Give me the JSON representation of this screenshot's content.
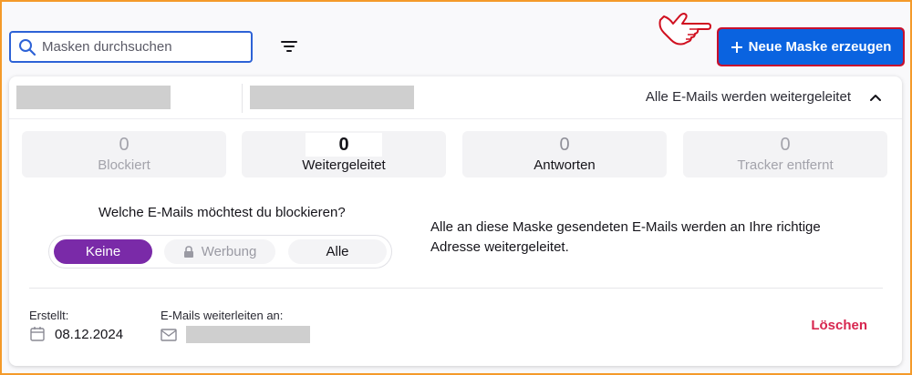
{
  "search": {
    "placeholder": "Masken durchsuchen"
  },
  "toolbar": {
    "new_mask_label": "Neue Maske erzeugen"
  },
  "mask": {
    "status_text": "Alle E-Mails werden weitergeleitet",
    "stats": [
      {
        "value": "0",
        "label": "Blockiert"
      },
      {
        "value": "0",
        "label": "Weitergeleitet"
      },
      {
        "value": "0",
        "label": "Antworten"
      },
      {
        "value": "0",
        "label": "Tracker entfernt"
      }
    ],
    "block_question": "Welche E-Mails möchtest du blockieren?",
    "block_options": [
      "Keine",
      "Werbung",
      "Alle"
    ],
    "selected_option": "Keine",
    "description": "Alle an diese Maske gesendeten E-Mails werden an Ihre richtige Adresse weitergeleitet.",
    "created_label": "Erstellt:",
    "created_date": "08.12.2024",
    "forward_label": "E-Mails weiterleiten an:",
    "delete_label": "Löschen"
  },
  "colors": {
    "primary_button": "#0a63e0",
    "highlight_border": "#c8102e",
    "selected_option": "#7a2aa8",
    "delete": "#d7264f",
    "frame": "#f49a2a"
  },
  "icons": [
    "search-icon",
    "filter-icon",
    "pointing-hand-icon",
    "plus-icon",
    "chevron-up-icon",
    "lock-icon",
    "calendar-icon",
    "envelope-icon"
  ]
}
